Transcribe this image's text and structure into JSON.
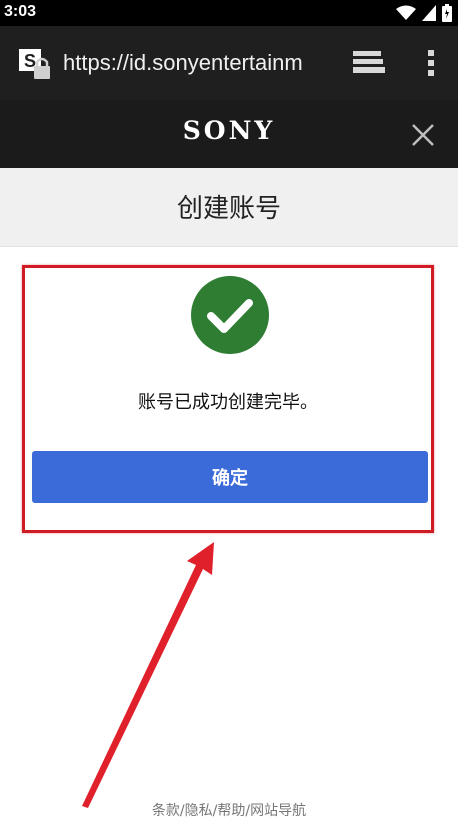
{
  "status_bar": {
    "time": "3:03",
    "icons": [
      "wifi-icon",
      "signal-icon",
      "battery-icon"
    ]
  },
  "browser": {
    "url": "https://id.sonyentertainm",
    "site_icon": "site-lock-icon",
    "tabs_icon": "tabs-icon",
    "menu_icon": "overflow-menu-icon"
  },
  "header": {
    "logo": "SONY",
    "close_icon": "close-icon"
  },
  "page": {
    "title": "创建账号"
  },
  "success": {
    "icon": "checkmark-icon",
    "message": "账号已成功创建完毕。",
    "confirm_label": "确定",
    "accent_color": "#3b6bd9",
    "check_color": "#2e7d32",
    "highlight_color": "#d11b24"
  },
  "footer": {
    "links": [
      "条款",
      "隐私",
      "帮助",
      "网站导航"
    ],
    "separator": "/"
  }
}
